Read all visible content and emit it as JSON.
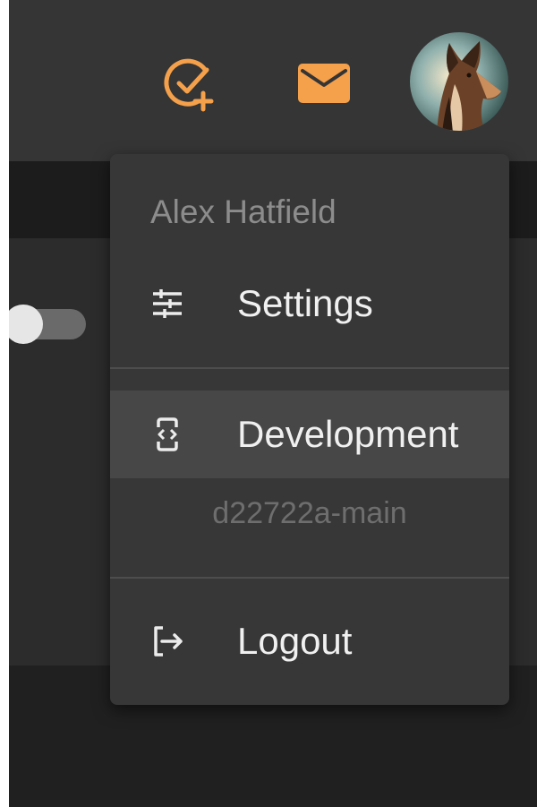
{
  "topbar": {
    "icons": {
      "add_task": "add-task-icon",
      "mail": "mail-icon"
    },
    "accent_color": "#f5a04a"
  },
  "user_menu": {
    "user_name": "Alex Hatfield",
    "items": [
      {
        "label": "Settings",
        "icon": "tune-icon"
      },
      {
        "label": "Development",
        "icon": "developer-mode-icon",
        "active": true
      },
      {
        "label": "Logout",
        "icon": "logout-icon"
      }
    ],
    "branch": "d22722a-main"
  },
  "background": {
    "toggle_on": false
  }
}
